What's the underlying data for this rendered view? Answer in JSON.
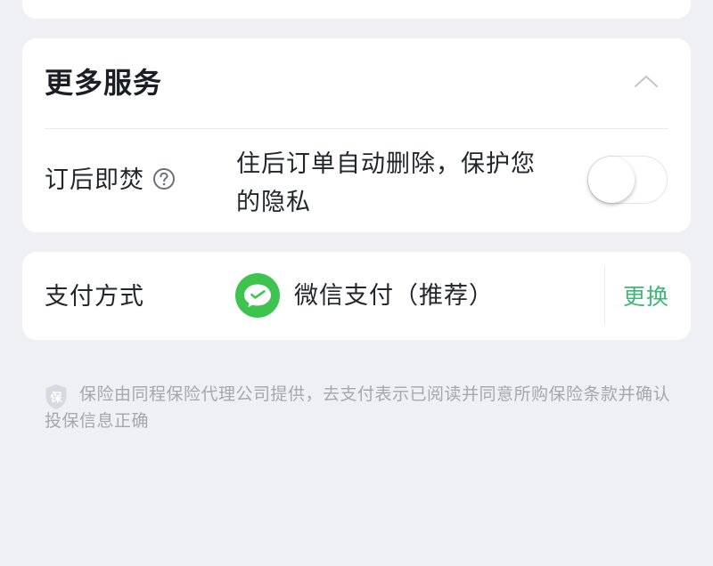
{
  "more_services": {
    "title": "更多服务",
    "collapse_icon": "chevron-up-icon",
    "burn_after_booking": {
      "label": "订后即焚",
      "help_icon": "question-circle-icon",
      "description": "住后订单自动删除，保护您的隐私",
      "toggle_on": false
    }
  },
  "payment": {
    "label": "支付方式",
    "method_icon": "wechat-pay-icon",
    "method": "微信支付（推荐）",
    "change_label": "更换"
  },
  "notice": {
    "icon": "insurance-shield-icon",
    "icon_glyph": "保",
    "text": "保险由同程保险代理公司提供，去支付表示已阅读并同意所购保险条款并确认投保信息正确"
  },
  "colors": {
    "background": "#eff0f4",
    "card": "#ffffff",
    "accent_green": "#3db878",
    "wechat_green": "#3ec34f",
    "muted_text": "#a4a7ae"
  }
}
